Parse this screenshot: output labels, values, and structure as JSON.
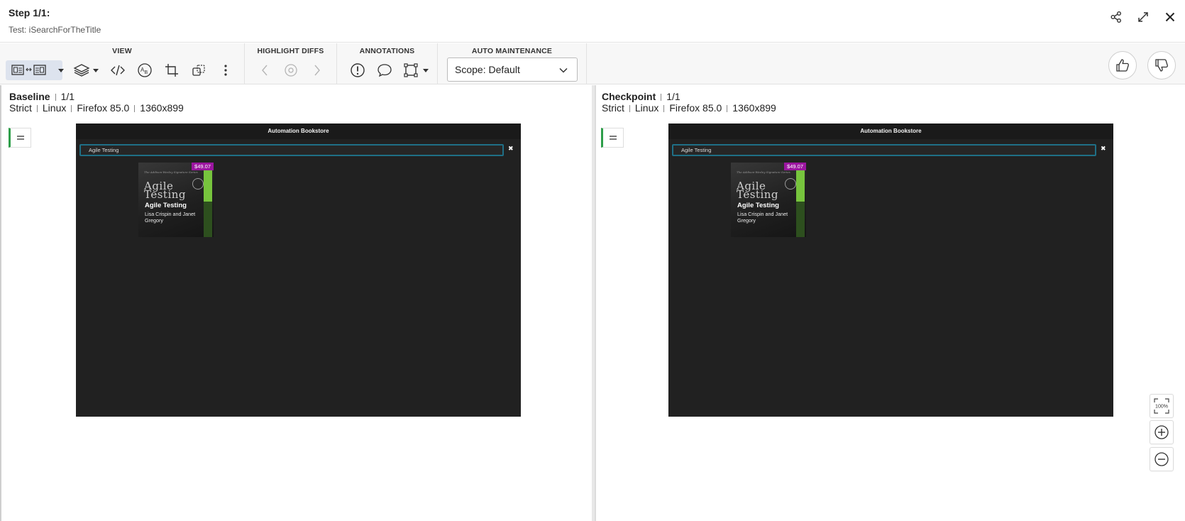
{
  "header": {
    "step_title": "Step 1/1:",
    "test_name": "Test: iSearchForTheTitle",
    "icons": [
      "share-icon",
      "expand-icon",
      "close-icon"
    ]
  },
  "toolbar": {
    "view": {
      "title": "VIEW",
      "icons": [
        "side-by-side-layout-icon",
        "layers-icon",
        "code-icon",
        "text-compare-icon",
        "crop-icon",
        "copy-region-icon",
        "more-vertical-icon"
      ]
    },
    "highlight": {
      "title": "HIGHLIGHT DIFFS",
      "icons": [
        "chevron-left-icon",
        "target-icon",
        "chevron-right-icon"
      ]
    },
    "annotations": {
      "title": "ANNOTATIONS",
      "icons": [
        "exclamation-icon",
        "comment-icon",
        "region-icon"
      ]
    },
    "auto_maintenance": {
      "title": "AUTO MAINTENANCE",
      "scope_value": "Scope: Default"
    }
  },
  "baseline": {
    "label": "Baseline",
    "index": "1/1",
    "match_level": "Strict",
    "os": "Linux",
    "browser": "Firefox 85.0",
    "viewport": "1360x899"
  },
  "checkpoint": {
    "label": "Checkpoint",
    "index": "1/1",
    "match_level": "Strict",
    "os": "Linux",
    "browser": "Firefox 85.0",
    "viewport": "1360x899"
  },
  "captured_page": {
    "app_title": "Automation Bookstore",
    "search_value": "Agile Testing",
    "clear_glyph": "✖",
    "book": {
      "price": "$49.07",
      "cover_series": "The Addison-Wesley Signature Series",
      "cover_title_line1": "Agile",
      "cover_title_line2": "Testing",
      "title": "Agile Testing",
      "author": "Lisa Crispin and Janet Gregory"
    }
  },
  "zoom": {
    "reset_label": "100%"
  },
  "colors": {
    "accent_green": "#2e9e4a",
    "price_tag": "#9b16a0",
    "search_border": "#1f6f86",
    "book_green": "#77c43d"
  }
}
